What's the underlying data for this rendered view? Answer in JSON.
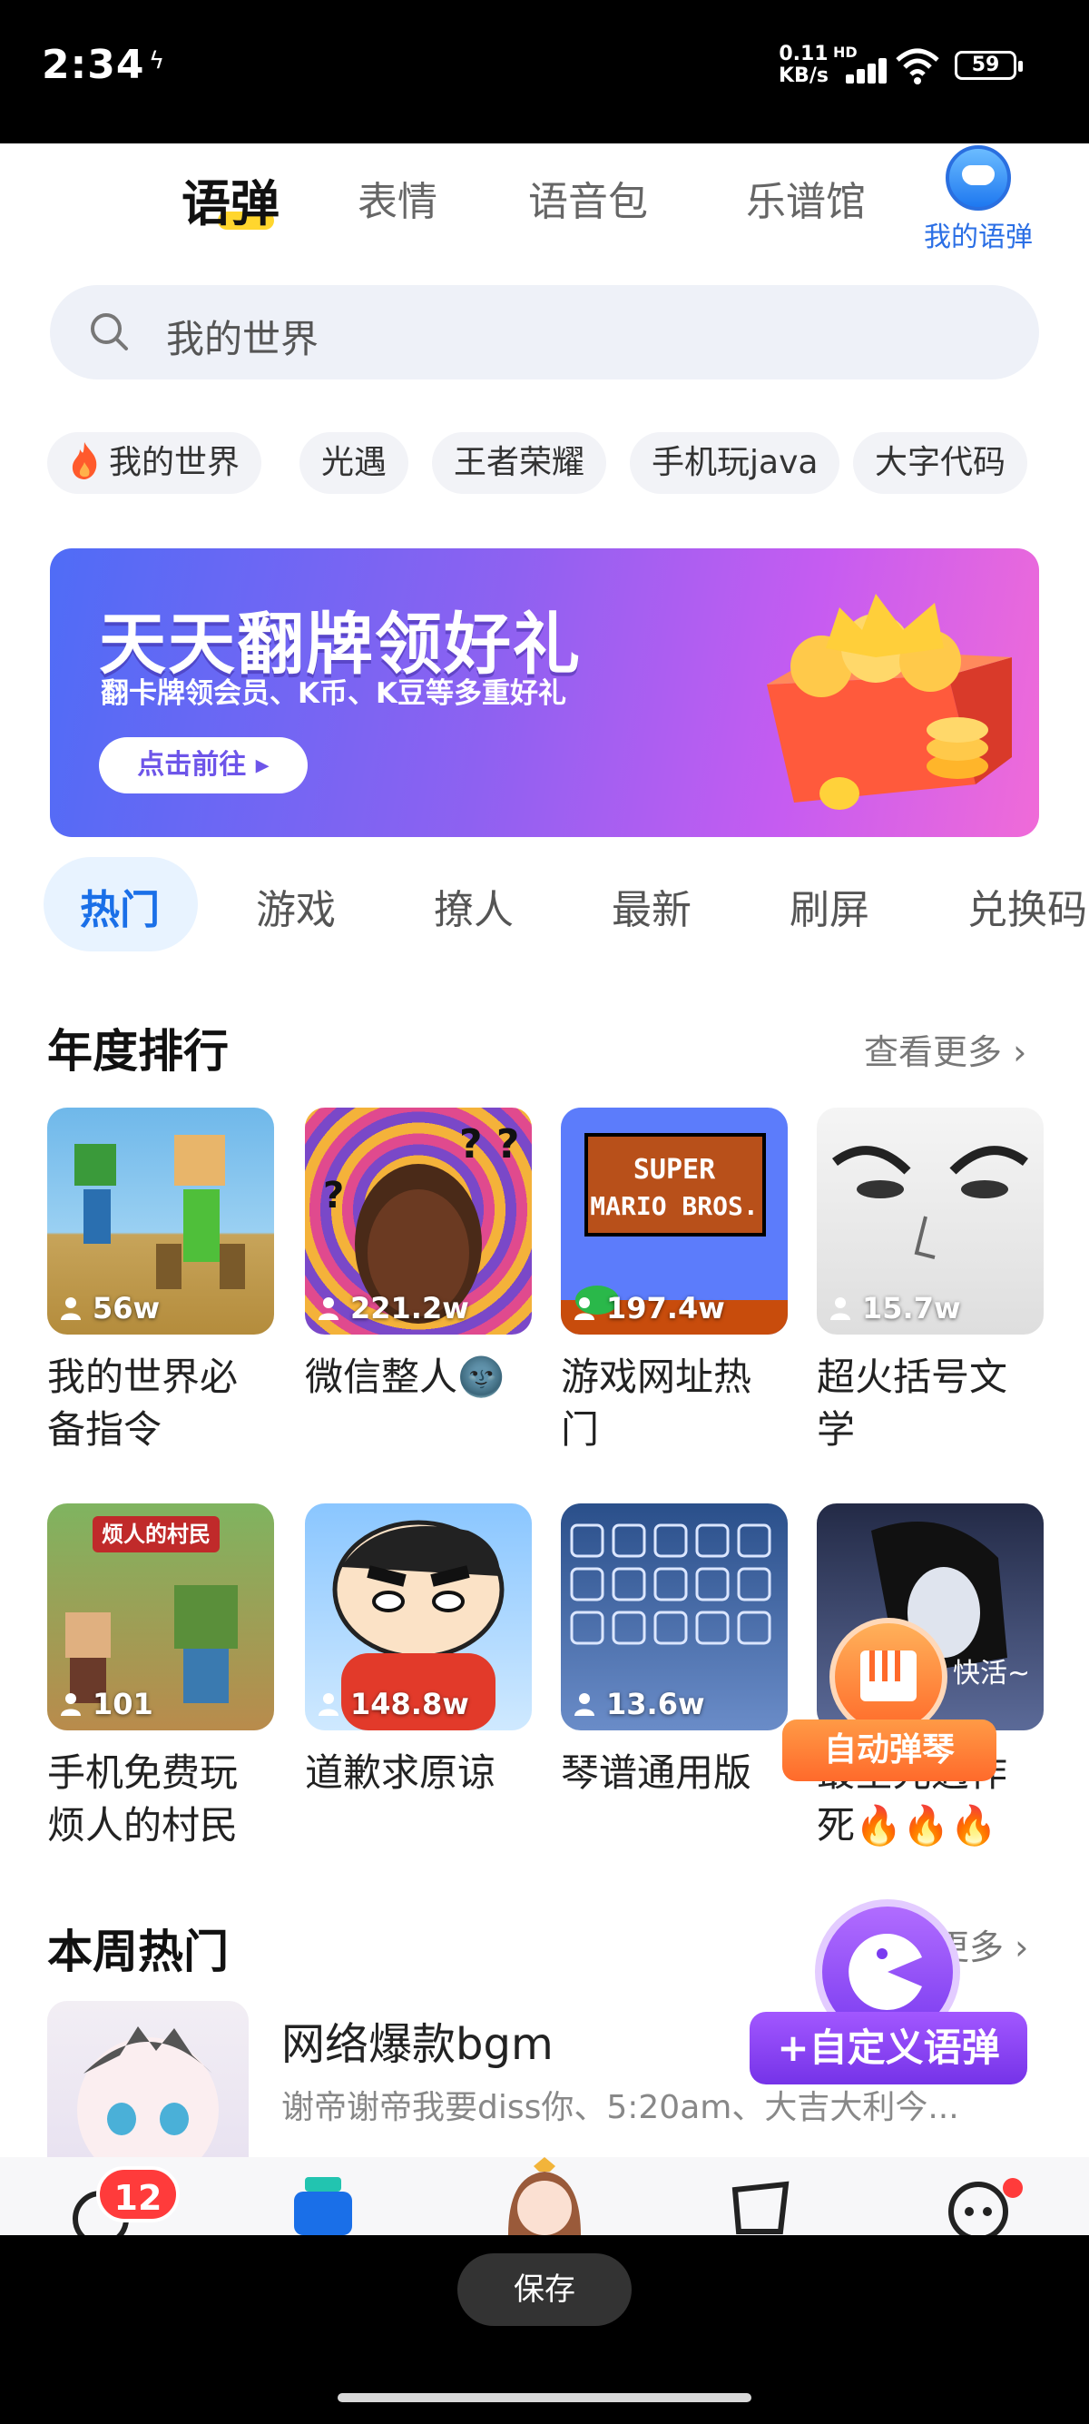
{
  "status_bar": {
    "time": "2:34",
    "extra": "ϟ",
    "net_speed_top": "0.11",
    "net_speed_bottom": "KB/s",
    "hd": "HD",
    "battery": "59"
  },
  "top_tabs": [
    {
      "label": "语弹",
      "active": true
    },
    {
      "label": "表情",
      "active": false
    },
    {
      "label": "语音包",
      "active": false
    },
    {
      "label": "乐谱馆",
      "active": false
    }
  ],
  "my_label": "我的语弹",
  "search": {
    "placeholder": "我的世界"
  },
  "chips": [
    "我的世界",
    "光遇",
    "王者荣耀",
    "手机玩java",
    "大字代码"
  ],
  "banner": {
    "title": "天天翻牌领好礼",
    "subtitle": "翻卡牌领会员、K币、K豆等多重好礼",
    "button": "点击前往 ▸"
  },
  "categories": [
    {
      "label": "热门",
      "active": true
    },
    {
      "label": "游戏",
      "active": false
    },
    {
      "label": "撩人",
      "active": false
    },
    {
      "label": "最新",
      "active": false
    },
    {
      "label": "刷屏",
      "active": false
    },
    {
      "label": "兑换码",
      "active": false
    }
  ],
  "annual": {
    "title": "年度排行",
    "more": "查看更多 ›",
    "cards": [
      {
        "title_line1": "我的世界必",
        "title_line2": "备指令",
        "count": "56w"
      },
      {
        "title_line1": "微信整人🌚",
        "title_line2": "",
        "count": "221.2w"
      },
      {
        "title_line1": "游戏网址热",
        "title_line2": "门",
        "count": "197.4w"
      },
      {
        "title_line1": "超火括号文",
        "title_line2": "学",
        "count": "15.7w"
      },
      {
        "title_line1": "手机免费玩",
        "title_line2": "烦人的村民",
        "count": "101"
      },
      {
        "title_line1": "道歉求原谅",
        "title_line2": "",
        "count": "148.8w"
      },
      {
        "title_line1": "琴谱通用版",
        "title_line2": "",
        "count": "13.6w"
      },
      {
        "title_line1": "最全光遇作",
        "title_line2": "死🔥🔥🔥",
        "count": ""
      }
    ],
    "thumb_texts": {
      "village_banner": "烦人的村民",
      "mario_title": "SUPER MARIO BROS.",
      "sky_text": "快活~"
    }
  },
  "weekly": {
    "title": "本周热门",
    "more": "更多 ›",
    "item": {
      "name": "网络爆款bgm",
      "desc": "谢帝谢帝我要diss你、5:20am、大吉大利今..."
    }
  },
  "floating": {
    "piano": "自动弹琴",
    "custom": "+自定义语弹"
  },
  "bottom_badge": "12",
  "save_button": "保存",
  "colors": {
    "accent": "#1a6fe8",
    "highlight": "#ffd62e",
    "badge": "#ff3b3b",
    "purple": "#7a3bf0",
    "orange": "#ff6a2b"
  }
}
